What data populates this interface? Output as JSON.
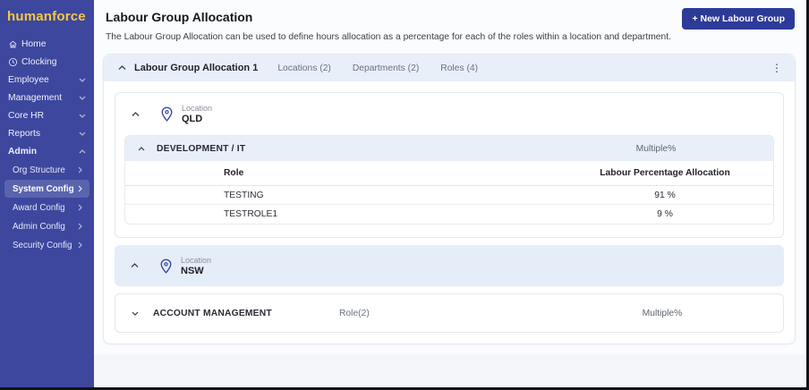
{
  "colors": {
    "sidebar_bg": "#3d479e",
    "sidebar_active_bg": "#5a64ae",
    "logo_yellow": "#f7c93e",
    "primary_button_bg": "#2d3a98",
    "accordion_header_bg": "#e9eff9",
    "location_band_bg": "#e5edf9"
  },
  "sidebar": {
    "logo": "humanforce",
    "items": [
      {
        "label": "Home",
        "icon": "home-icon"
      },
      {
        "label": "Clocking",
        "icon": "clock-icon"
      },
      {
        "label": "Employee",
        "chevron": "down"
      },
      {
        "label": "Management",
        "chevron": "down"
      },
      {
        "label": "Core HR",
        "chevron": "down"
      },
      {
        "label": "Reports",
        "chevron": "down"
      },
      {
        "label": "Admin",
        "chevron": "up"
      }
    ],
    "admin_subitems": [
      {
        "label": "Org Structure"
      },
      {
        "label": "System Config",
        "active": true
      },
      {
        "label": "Award Config"
      },
      {
        "label": "Admin Config"
      },
      {
        "label": "Security Config"
      }
    ]
  },
  "header": {
    "title": "Labour Group Allocation",
    "description": "The Labour Group Allocation can be used to define hours allocation as a percentage for each of the roles within a location and department.",
    "new_button": "+ New Labour Group"
  },
  "icons": {
    "kebab": "⋮"
  },
  "group": {
    "title": "Labour Group Allocation 1",
    "meta": [
      "Locations (2)",
      "Departments (2)",
      "Roles (4)"
    ],
    "qld": {
      "label": "Location",
      "name": "QLD",
      "department": {
        "name": "DEVELOPMENT / IT",
        "allocation": "Multiple%"
      },
      "table": {
        "headers": [
          "Role",
          "Labour Percentage Allocation"
        ],
        "rows": [
          {
            "role": "TESTING",
            "allocation": "91 %"
          },
          {
            "role": "TESTROLE1",
            "allocation": "9 %"
          }
        ]
      }
    },
    "nsw": {
      "label": "Location",
      "name": "NSW",
      "department": {
        "name": "ACCOUNT MANAGEMENT",
        "roles": "Role(2)",
        "allocation": "Multiple%"
      }
    }
  }
}
